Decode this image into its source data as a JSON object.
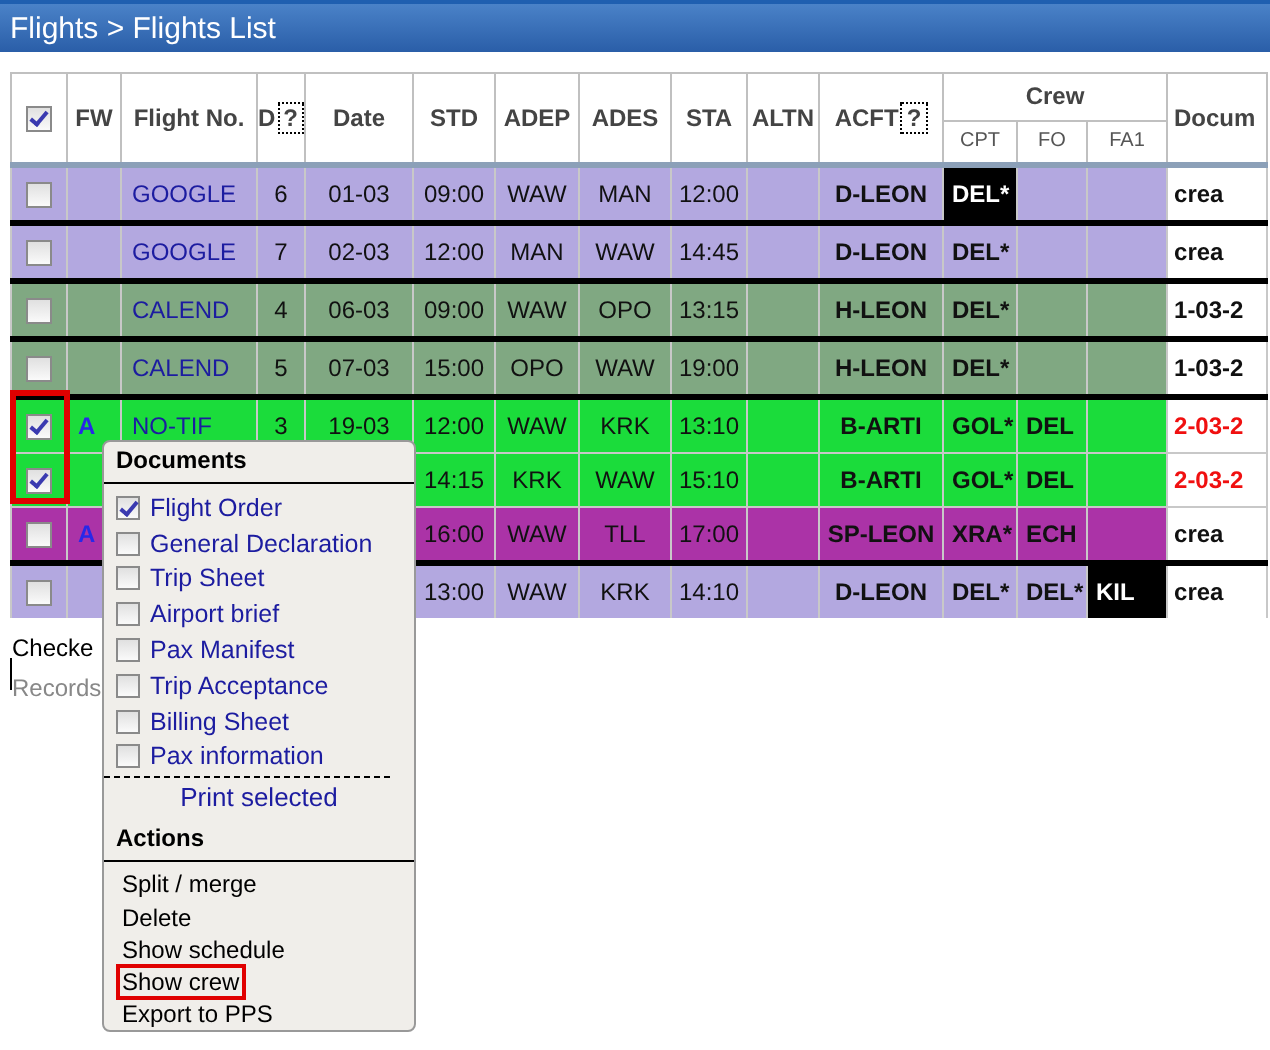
{
  "window": {
    "title": "Flights > Flights List"
  },
  "table": {
    "select_all_checked": true,
    "columns": [
      {
        "label": "FW"
      },
      {
        "label": "Flight No."
      },
      {
        "label": "D",
        "help": "?"
      },
      {
        "label": "Date"
      },
      {
        "label": "STD"
      },
      {
        "label": "ADEP"
      },
      {
        "label": "ADES"
      },
      {
        "label": "STA"
      },
      {
        "label": "ALTN"
      },
      {
        "label": "ACFT",
        "help": "?"
      }
    ],
    "crew_header": {
      "label": "Crew",
      "roles": [
        "CPT",
        "FO",
        "FA1"
      ]
    },
    "docs_header": "Docum",
    "rows": [
      {
        "checked": false,
        "color": "#b3a8e0",
        "divider_above": false,
        "fw": "",
        "flight": "GOOGLE",
        "d": "6",
        "date": "01-03",
        "std": "09:00",
        "adep": "WAW",
        "ades": "MAN",
        "sta": "12:00",
        "acft": "D-LEON",
        "crew": [
          {
            "text": "DEL*",
            "highlighted": true
          }
        ],
        "doc": {
          "text": "crea",
          "alert": false
        }
      },
      {
        "checked": false,
        "color": "#b3a8e0",
        "divider_above": true,
        "fw": "",
        "flight": "GOOGLE",
        "d": "7",
        "date": "02-03",
        "std": "12:00",
        "adep": "MAN",
        "ades": "WAW",
        "sta": "14:45",
        "acft": "D-LEON",
        "crew": [
          {
            "text": "DEL*",
            "highlighted": false
          }
        ],
        "doc": {
          "text": "crea",
          "alert": false
        }
      },
      {
        "checked": false,
        "color": "#80a882",
        "divider_above": true,
        "fw": "",
        "flight": "CALEND",
        "d": "4",
        "date": "06-03",
        "std": "09:00",
        "adep": "WAW",
        "ades": "OPO",
        "sta": "13:15",
        "acft": "H-LEON",
        "crew": [
          {
            "text": "DEL*",
            "highlighted": false
          }
        ],
        "doc": {
          "text": "1-03-2",
          "alert": false
        }
      },
      {
        "checked": false,
        "color": "#80a882",
        "divider_above": true,
        "fw": "",
        "flight": "CALEND",
        "d": "5",
        "date": "07-03",
        "std": "15:00",
        "adep": "OPO",
        "ades": "WAW",
        "sta": "19:00",
        "acft": "H-LEON",
        "crew": [
          {
            "text": "DEL*",
            "highlighted": false
          }
        ],
        "doc": {
          "text": "1-03-2",
          "alert": false
        }
      },
      {
        "checked": true,
        "color": "#1bdc3b",
        "divider_above": true,
        "fw": "A",
        "flight": "NO-TIF",
        "d": "3",
        "date": "19-03",
        "std": "12:00",
        "adep": "WAW",
        "ades": "KRK",
        "sta": "13:10",
        "acft": "B-ARTI",
        "crew": [
          {
            "text": "GOL*",
            "highlighted": false
          },
          {
            "text": "DEL",
            "highlighted": false
          }
        ],
        "doc": {
          "text": "2-03-2",
          "alert": true
        }
      },
      {
        "checked": true,
        "color": "#1bdc3b",
        "divider_above": false,
        "fw": "",
        "flight": "",
        "d": "",
        "date": "",
        "std": "14:15",
        "adep": "KRK",
        "ades": "WAW",
        "sta": "15:10",
        "acft": "B-ARTI",
        "crew": [
          {
            "text": "GOL*",
            "highlighted": false
          },
          {
            "text": "DEL",
            "highlighted": false
          }
        ],
        "doc": {
          "text": "2-03-2",
          "alert": true
        }
      },
      {
        "checked": false,
        "color": "#ab33a7",
        "divider_above": false,
        "fw": "A",
        "flight": "",
        "d": "",
        "date": "",
        "std": "16:00",
        "adep": "WAW",
        "ades": "TLL",
        "sta": "17:00",
        "acft": "SP-LEON",
        "crew": [
          {
            "text": "XRA*",
            "highlighted": false
          },
          {
            "text": "ECH",
            "highlighted": false
          }
        ],
        "doc": {
          "text": "crea",
          "alert": false
        }
      },
      {
        "checked": false,
        "color": "#b3a8e0",
        "divider_above": true,
        "fw": "",
        "flight": "",
        "d": "",
        "date": "",
        "std": "13:00",
        "adep": "WAW",
        "ades": "KRK",
        "sta": "14:10",
        "acft": "D-LEON",
        "crew": [
          {
            "text": "DEL*",
            "highlighted": false
          },
          {
            "text": "DEL*",
            "highlighted": false
          },
          {
            "text": "KIL",
            "highlighted": true
          }
        ],
        "doc": {
          "text": "crea",
          "alert": false
        }
      }
    ]
  },
  "footer": {
    "checked_label": "Checke",
    "records_label": "Records"
  },
  "menu": {
    "documents_title": "Documents",
    "documents": [
      {
        "label": "Flight Order",
        "checked": true
      },
      {
        "label": "General Declaration",
        "checked": false
      },
      {
        "label": "Trip Sheet",
        "checked": false
      },
      {
        "label": "Airport brief",
        "checked": false
      },
      {
        "label": "Pax Manifest",
        "checked": false
      },
      {
        "label": "Trip Acceptance",
        "checked": false
      },
      {
        "label": "Billing Sheet",
        "checked": false
      },
      {
        "label": "Pax information",
        "checked": false
      }
    ],
    "print_label": "Print selected",
    "actions_title": "Actions",
    "actions": [
      {
        "label": "Split / merge",
        "highlighted": false
      },
      {
        "label": "Delete",
        "highlighted": false
      },
      {
        "label": "Show schedule",
        "highlighted": false
      },
      {
        "label": "Show crew",
        "highlighted": true
      },
      {
        "label": "Export to PPS",
        "highlighted": false
      }
    ]
  }
}
